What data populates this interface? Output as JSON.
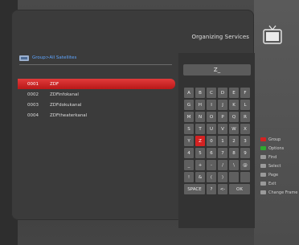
{
  "header": {
    "title": "Organizing Services"
  },
  "group": {
    "label": "Group>All Satellites"
  },
  "channels": [
    {
      "num": "0001",
      "name": "ZDF",
      "selected": true
    },
    {
      "num": "0002",
      "name": "ZDFinfokanal",
      "selected": false
    },
    {
      "num": "0003",
      "name": "ZDFdokukanal",
      "selected": false
    },
    {
      "num": "0004",
      "name": "ZDFtheaterkanal",
      "selected": false
    }
  ],
  "keyboard": {
    "input_value": "Z_",
    "rows": [
      [
        "A",
        "B",
        "C",
        "D",
        "E",
        "F"
      ],
      [
        "G",
        "H",
        "I",
        "J",
        "K",
        "L"
      ],
      [
        "M",
        "N",
        "O",
        "P",
        "Q",
        "R"
      ],
      [
        "S",
        "T",
        "U",
        "V",
        "W",
        "X"
      ],
      [
        "Y",
        "Z",
        "0",
        "1",
        "2",
        "3"
      ],
      [
        "4",
        "5",
        "6",
        "7",
        "8",
        "9"
      ],
      [
        "_",
        "+",
        "-",
        "/",
        "\\",
        "@"
      ],
      [
        "!",
        "&",
        "(",
        ")",
        "",
        ""
      ]
    ],
    "bottom_row": [
      "SPACE",
      "?",
      "<-",
      "OK"
    ],
    "selected_key": "Z"
  },
  "legend": {
    "items": [
      {
        "label": "Group",
        "icon": "red-button-icon",
        "color": "#d42222"
      },
      {
        "label": "Options",
        "icon": "green-button-icon",
        "color": "#2faa2f"
      },
      {
        "label": "Find",
        "icon": "find-icon",
        "color": "#9a9a9a"
      },
      {
        "label": "Select",
        "icon": "select-icon",
        "color": "#9a9a9a"
      },
      {
        "label": "Page",
        "icon": "page-icon",
        "color": "#9a9a9a"
      },
      {
        "label": "Exit",
        "icon": "exit-icon",
        "color": "#9a9a9a"
      },
      {
        "label": "Change Frame",
        "icon": "change-frame-icon",
        "color": "#9a9a9a"
      }
    ]
  },
  "colors": {
    "accent_red": "#d42222",
    "link_blue": "#5fa6ff"
  }
}
